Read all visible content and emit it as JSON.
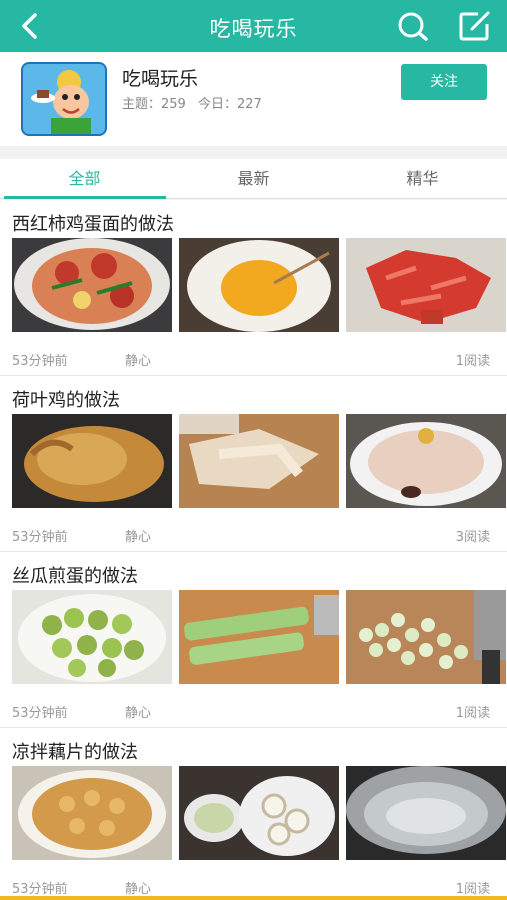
{
  "topbar": {
    "title": "吃喝玩乐",
    "back_icon": "chevron-left-icon",
    "search_icon": "search-icon",
    "edit_icon": "edit-icon"
  },
  "forum": {
    "name": "吃喝玩乐",
    "topics_label": "主题：259",
    "today_label": "今日：227",
    "follow_label": "关注"
  },
  "tabs": [
    {
      "label": "全部",
      "active": true
    },
    {
      "label": "最新",
      "active": false
    },
    {
      "label": "精华",
      "active": false
    }
  ],
  "posts": [
    {
      "title": "西红柿鸡蛋面的做法",
      "time": "53分钟前",
      "author": "静心",
      "reads": "1阅读"
    },
    {
      "title": "荷叶鸡的做法",
      "time": "53分钟前",
      "author": "静心",
      "reads": "3阅读"
    },
    {
      "title": "丝瓜煎蛋的做法",
      "time": "53分钟前",
      "author": "静心",
      "reads": "1阅读"
    },
    {
      "title": "凉拌藕片的做法",
      "time": "53分钟前",
      "author": "静心",
      "reads": "1阅读"
    }
  ],
  "colors": {
    "accent": "#27b8a4",
    "meta_text": "#999999"
  }
}
